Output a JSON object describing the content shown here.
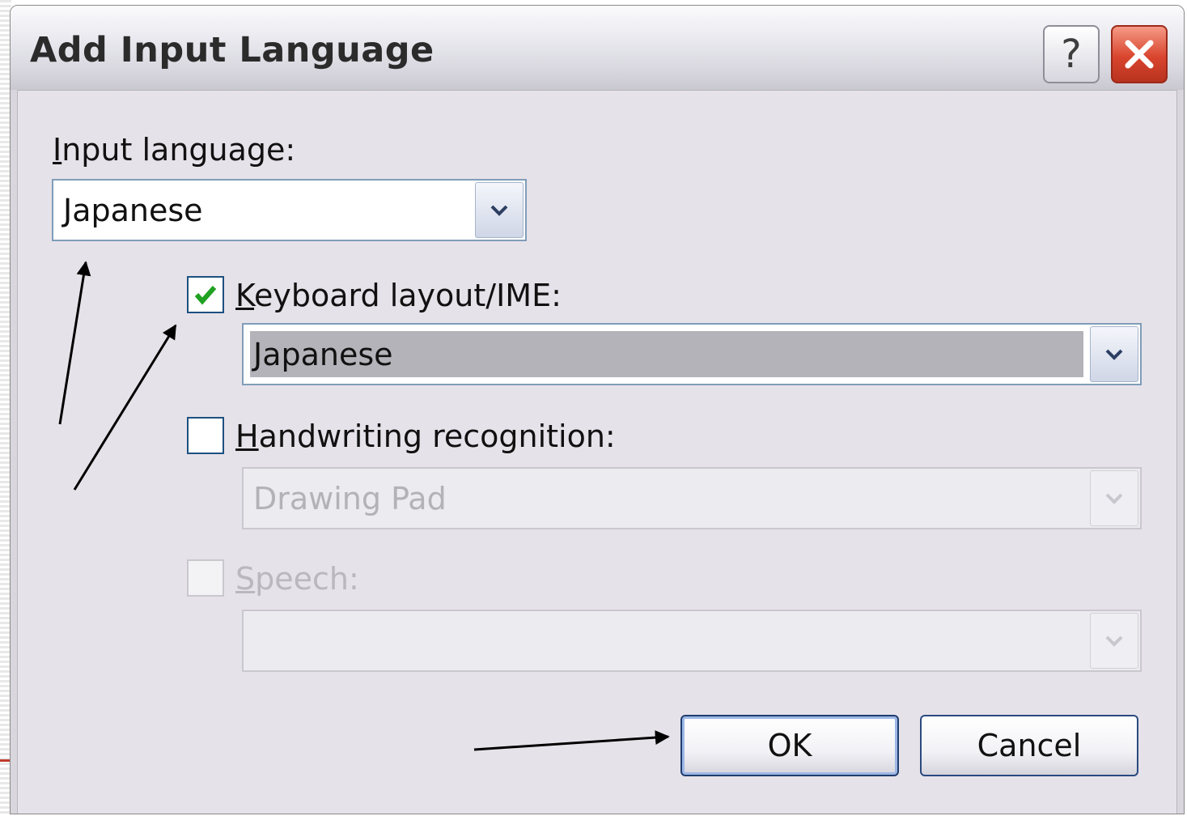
{
  "dialog": {
    "title": "Add Input Language",
    "help_glyph": "?",
    "input_language": {
      "label_mnemonic": "I",
      "label_rest": "nput language:",
      "value": "Japanese"
    },
    "keyboard_layout": {
      "checked": true,
      "label_mnemonic": "K",
      "label_rest": "eyboard layout/IME:",
      "value": "Japanese"
    },
    "handwriting": {
      "checked": false,
      "label_mnemonic": "H",
      "label_rest": "andwriting recognition:",
      "value": "Drawing Pad",
      "enabled": false
    },
    "speech": {
      "checked": false,
      "label_mnemonic": "S",
      "label_rest": "peech:",
      "value": "",
      "enabled": false
    },
    "buttons": {
      "ok": "OK",
      "cancel": "Cancel"
    }
  },
  "colors": {
    "dialog_bg": "#e6e2e9",
    "field_border": "#7f9db9",
    "checkmark": "#21a121",
    "close_button": "#d9452e",
    "annotation_arrow": "#000000"
  }
}
